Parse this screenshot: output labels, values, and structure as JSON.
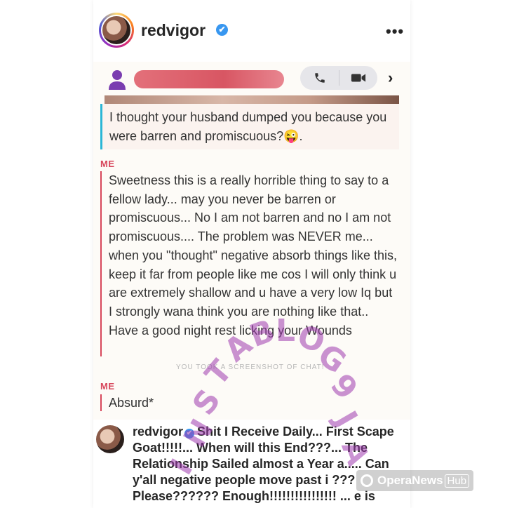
{
  "post": {
    "username": "redvigor",
    "verified_mark": "✔",
    "more_label": "•••"
  },
  "chat": {
    "back_chevron": "›",
    "quoted_message": "I thought your husband dumped you because you were barren and promiscuous?😜.",
    "messages": [
      {
        "sender": "ME",
        "text": "Sweetness this is a really horrible thing to say to a fellow lady... may you never be barren or promiscuous... No I am not barren and no I am not promiscuous.... The problem was NEVER me... when you \"thought\" negative absorb things like this, keep it far from people like me cos I will only think u are extremely shallow and u have a very low Iq but I strongly wana think you are nothing like that.. Have a good night rest licking your Wounds"
      },
      {
        "sender": "ME",
        "text": "Absurd*"
      }
    ],
    "screenshot_notice": "YOU TOOK A SCREENSHOT OF CHAT!"
  },
  "caption": {
    "username": "redvigor",
    "verified_mark": "✔",
    "text": "Shit I Receive Daily... First Scape Goat!!!!!... When will this End???... The Relationship Sailed almost a Year a..... Can y'all negative people move past i ??? Please?????? Enough!!!!!!!!!!!!!!!! ... e is"
  },
  "watermark": {
    "letters": [
      "I",
      "N",
      "S",
      "T",
      "A",
      "B",
      "L",
      "O",
      "G",
      "9",
      "J",
      "A"
    ]
  },
  "badge": {
    "brand": "OperaNews",
    "hub": "Hub"
  }
}
